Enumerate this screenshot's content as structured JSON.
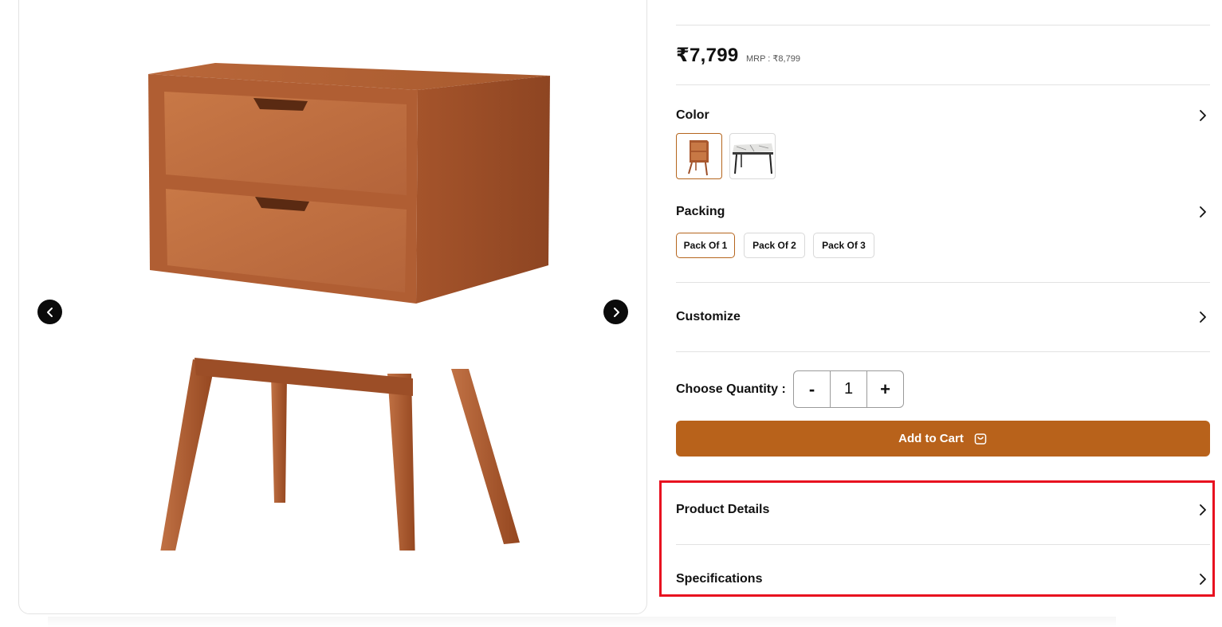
{
  "product": {
    "price": "₹7,799",
    "mrp": "MRP : ₹8,799",
    "image_alt": "wooden-bedside-table-icon"
  },
  "gallery": {
    "prev_icon": "chevron-left-icon",
    "next_icon": "chevron-right-icon"
  },
  "color": {
    "title": "Color",
    "options": [
      {
        "icon": "wooden-nightstand-thumbnail-icon",
        "selected": true
      },
      {
        "icon": "marble-table-thumbnail-icon",
        "selected": false
      }
    ]
  },
  "packing": {
    "title": "Packing",
    "options": [
      "Pack Of 1",
      "Pack Of 2",
      "Pack Of 3"
    ],
    "selected": "Pack Of 1"
  },
  "customize": {
    "title": "Customize"
  },
  "quantity": {
    "label": "Choose Quantity :",
    "minus": "-",
    "value": "1",
    "plus": "+"
  },
  "cart": {
    "label": "Add to Cart",
    "icon": "shopping-bag-icon"
  },
  "accordion": {
    "product_details": "Product Details",
    "specifications": "Specifications"
  },
  "colors": {
    "accent": "#b8621b",
    "highlight": "#e8101f",
    "divider": "#e2e2e2"
  }
}
